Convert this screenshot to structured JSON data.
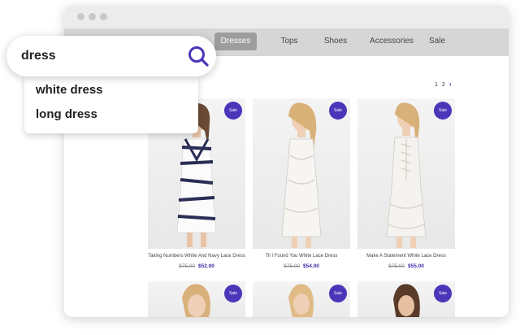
{
  "search": {
    "query": "dress",
    "suggestions": [
      "white dress",
      "long dress"
    ]
  },
  "nav": {
    "items": [
      "Dresses",
      "Tops",
      "Shoes",
      "Accessories",
      "Sale"
    ],
    "active": "Dresses"
  },
  "pagination": {
    "pages": [
      "1",
      "2"
    ],
    "next": "›"
  },
  "products": [
    {
      "badge": "Sale",
      "title": "Taking Numbers White And Navy Lace Dress",
      "old_price": "$75.00",
      "price": "$52.00"
    },
    {
      "badge": "Sale",
      "title": "Til I Found You White Lace Dress",
      "old_price": "$75.00",
      "price": "$54.00"
    },
    {
      "badge": "Sale",
      "title": "Make A Statement White Lace Dress",
      "old_price": "$75.00",
      "price": "$55.00"
    },
    {
      "badge": "Sale"
    },
    {
      "badge": "Sale"
    },
    {
      "badge": "Sale"
    }
  ],
  "colors": {
    "accent": "#4b35b9",
    "nav_bar": "#d6d6d6",
    "nav_active": "#9d9d9d"
  },
  "icons": {
    "search": "search-icon"
  }
}
